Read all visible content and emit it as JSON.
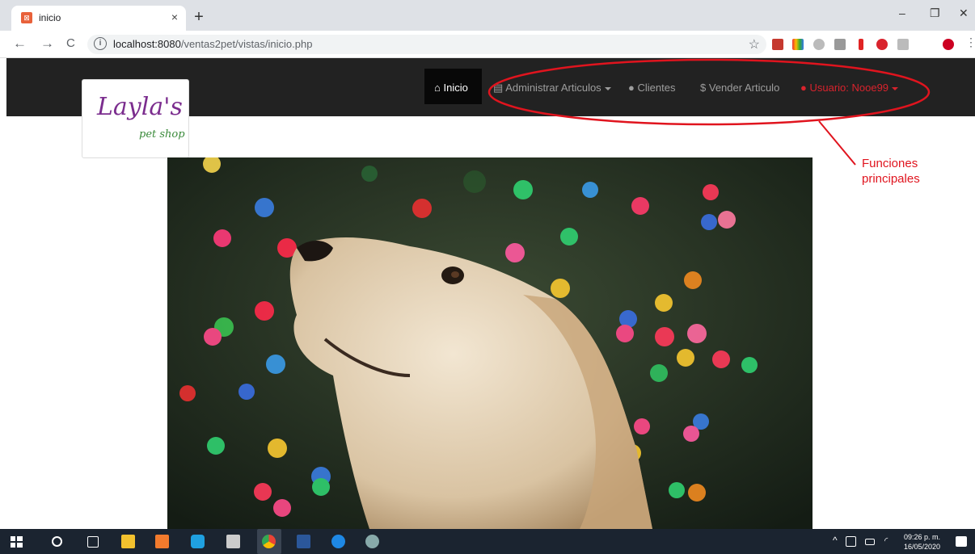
{
  "browser": {
    "tab": {
      "title": "inicio",
      "close": "×"
    },
    "new_tab": "+",
    "window_controls": {
      "minimize": "–",
      "restore": "❐",
      "close": "✕"
    },
    "nav": {
      "back": "←",
      "forward": "→",
      "reload": "C"
    },
    "address": {
      "host": "localhost:8080",
      "path": "/ventas2pet/vistas/inicio.php"
    },
    "bookmark": "☆"
  },
  "site": {
    "logo": {
      "main": "Layla's",
      "sub": "pet shop"
    },
    "nav": {
      "home": {
        "icon": "home-icon",
        "label": "Inicio"
      },
      "articles": {
        "icon": "list-icon",
        "label": "Administrar Articulos"
      },
      "clients": {
        "icon": "user-icon",
        "label": "Clientes"
      },
      "sell": {
        "icon": "dollar-icon",
        "label": "Vender Articulo"
      },
      "user": {
        "icon": "user-icon",
        "label": "Usuario: Nooe99"
      }
    },
    "hero": {
      "icon": "dog-photo"
    }
  },
  "annotation": {
    "line1": "Funciones",
    "line2": "principales",
    "color": "#e0141e"
  },
  "taskbar": {
    "time": "09:26 p. m.",
    "date": "16/05/2020"
  },
  "colors": {
    "navbar": "#222222",
    "nav_active": "#080808",
    "user_link": "#d9232d"
  }
}
